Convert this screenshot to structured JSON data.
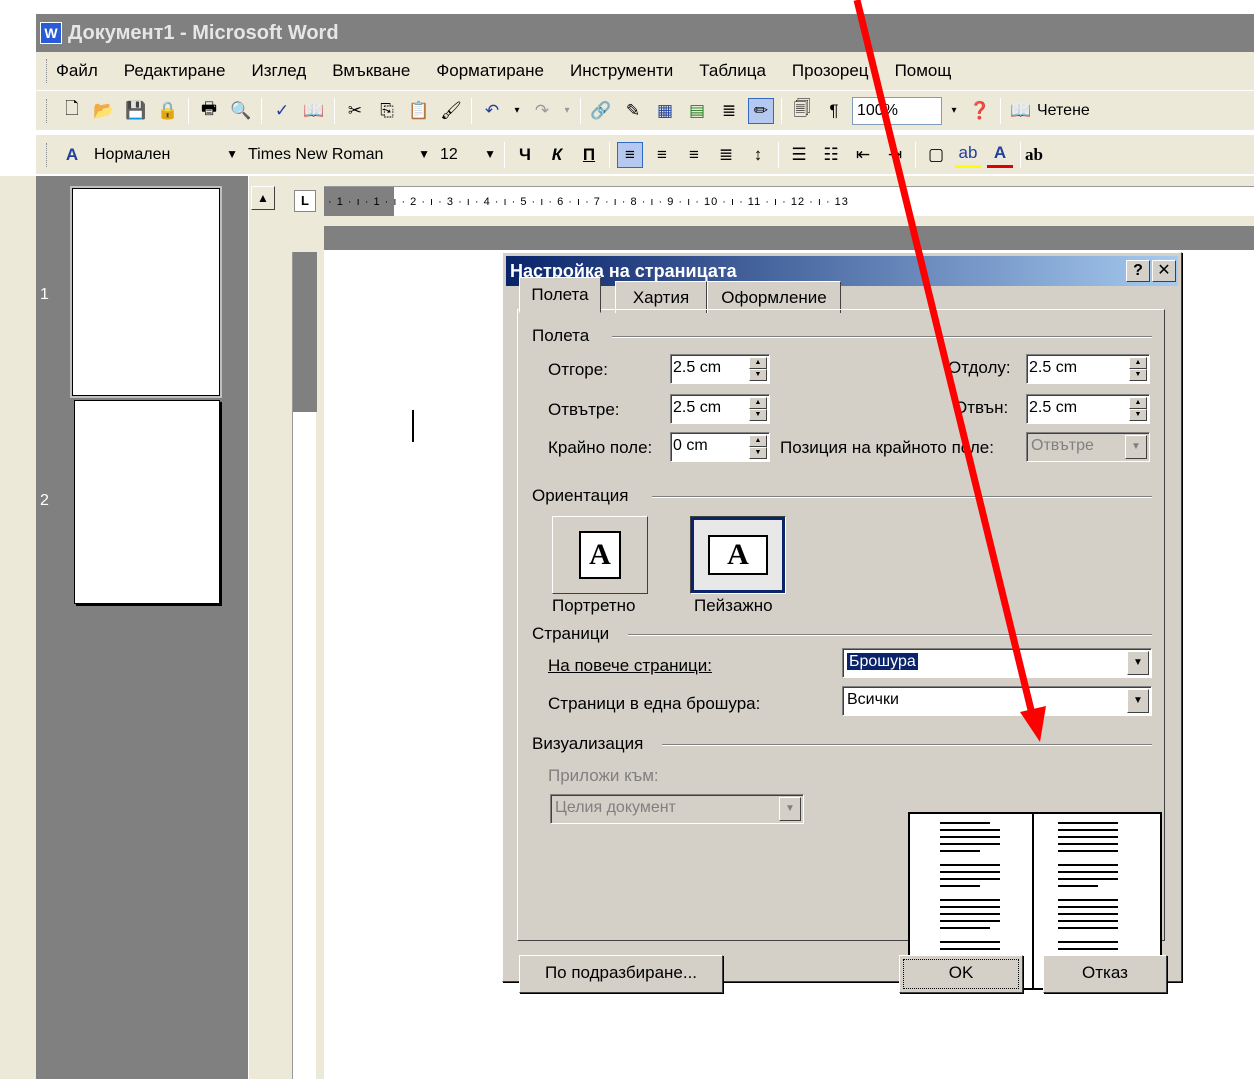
{
  "window": {
    "title": "Документ1 - Microsoft Word",
    "app_icon": "W"
  },
  "menu": {
    "items": [
      "Файл",
      "Редактиране",
      "Изглед",
      "Вмъкване",
      "Форматиране",
      "Инструменти",
      "Таблица",
      "Прозорец",
      "Помощ"
    ]
  },
  "toolbar_standard": {
    "zoom": "100%",
    "read_label": "Четене"
  },
  "toolbar_format": {
    "style": "Нормален",
    "font": "Times New Roman",
    "size": "12",
    "bold": "Ч",
    "italic": "К",
    "underline": "П",
    "more": "ab"
  },
  "ruler": {
    "text": "· 1 · ı · 1 · ı · 2 · ı · 3 · ı · 4 · ı · 5 · ı · 6 · ı · 7 · ı · 8 · ı · 9 · ı · 10 · ı · 11 · ı · 12 · ı · 13",
    "tab_marker": "L"
  },
  "thumbnails": {
    "pages": [
      "1",
      "2"
    ]
  },
  "dialog": {
    "title": "Настройка на страницата",
    "help_btn": "?",
    "close_btn": "✕",
    "tabs": [
      "Полета",
      "Хартия",
      "Оформление"
    ],
    "margins": {
      "group": "Полета",
      "top_label": "Отгоре:",
      "top_value": "2.5 cm",
      "bottom_label": "Отдолу:",
      "bottom_value": "2.5 cm",
      "inside_label": "Отвътре:",
      "inside_value": "2.5 cm",
      "outside_label": "Отвън:",
      "outside_value": "2.5 cm",
      "gutter_label": "Крайно поле:",
      "gutter_value": "0 cm",
      "gutter_pos_label": "Позиция на крайното поле:",
      "gutter_pos_value": "Отвътре"
    },
    "orientation": {
      "group": "Ориентация",
      "portrait": "Портретно",
      "landscape": "Пейзажно",
      "glyph": "A"
    },
    "pages": {
      "group": "Страници",
      "multiple_label": "На повече страници:",
      "multiple_value": "Брошура",
      "per_booklet_label": "Страници в една брошура:",
      "per_booklet_value": "Всички"
    },
    "preview": {
      "group": "Визуализация",
      "apply_label": "Приложи към:",
      "apply_value": "Целия документ"
    },
    "buttons": {
      "default": "По подразбиране...",
      "ok": "OK",
      "cancel": "Отказ"
    }
  },
  "annotation": {
    "arrow_color": "#ff0000"
  }
}
